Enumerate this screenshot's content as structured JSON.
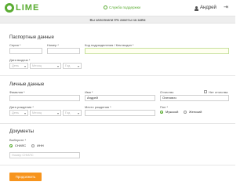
{
  "header": {
    "logo_text": "LIME",
    "support_label": "Служба поддержки",
    "user_name": "Андрей"
  },
  "progress": {
    "text": "Вы заполнили 0% анкеты на заём",
    "percent": 0
  },
  "passport": {
    "title": "Паспортные данные",
    "series_label": "Серия *",
    "number_label": "Номер *",
    "division_label": "Код подразделения / Кем выдан *",
    "issue_date_label": "Дата выдачи *",
    "day_placeholder": "День",
    "month_placeholder": "Месяц",
    "year_placeholder": "Год"
  },
  "personal": {
    "title": "Личные данные",
    "lastname_label": "Фамилия *",
    "firstname_label": "Имя *",
    "firstname_value": "Андрей",
    "patronymic_label": "Отчество",
    "patronymic_value": "Олегович",
    "no_patronymic_label": "Нет отчества",
    "birthdate_label": "Дата рождения *",
    "birthplace_label": "Место рождения *",
    "gender_label": "Пол *",
    "gender_male": "Мужской",
    "gender_female": "Женский",
    "day_placeholder": "День",
    "month_placeholder": "Месяц",
    "year_placeholder": "Год"
  },
  "documents": {
    "title": "Документы",
    "choose_label": "Выберите *",
    "option_snils": "СНИЛС",
    "option_inn": "ИНН",
    "snils_placeholder": "Номер СНИЛС"
  },
  "submit_label": "Продолжить",
  "icons": {
    "logo": "lime-logo-icon",
    "support": "support-icon",
    "user": "user-icon",
    "logout": "logout-icon",
    "dropdown": "chevron-down-icon"
  },
  "colors": {
    "brand_green": "#5aac32",
    "button_orange": "#f7941d"
  }
}
